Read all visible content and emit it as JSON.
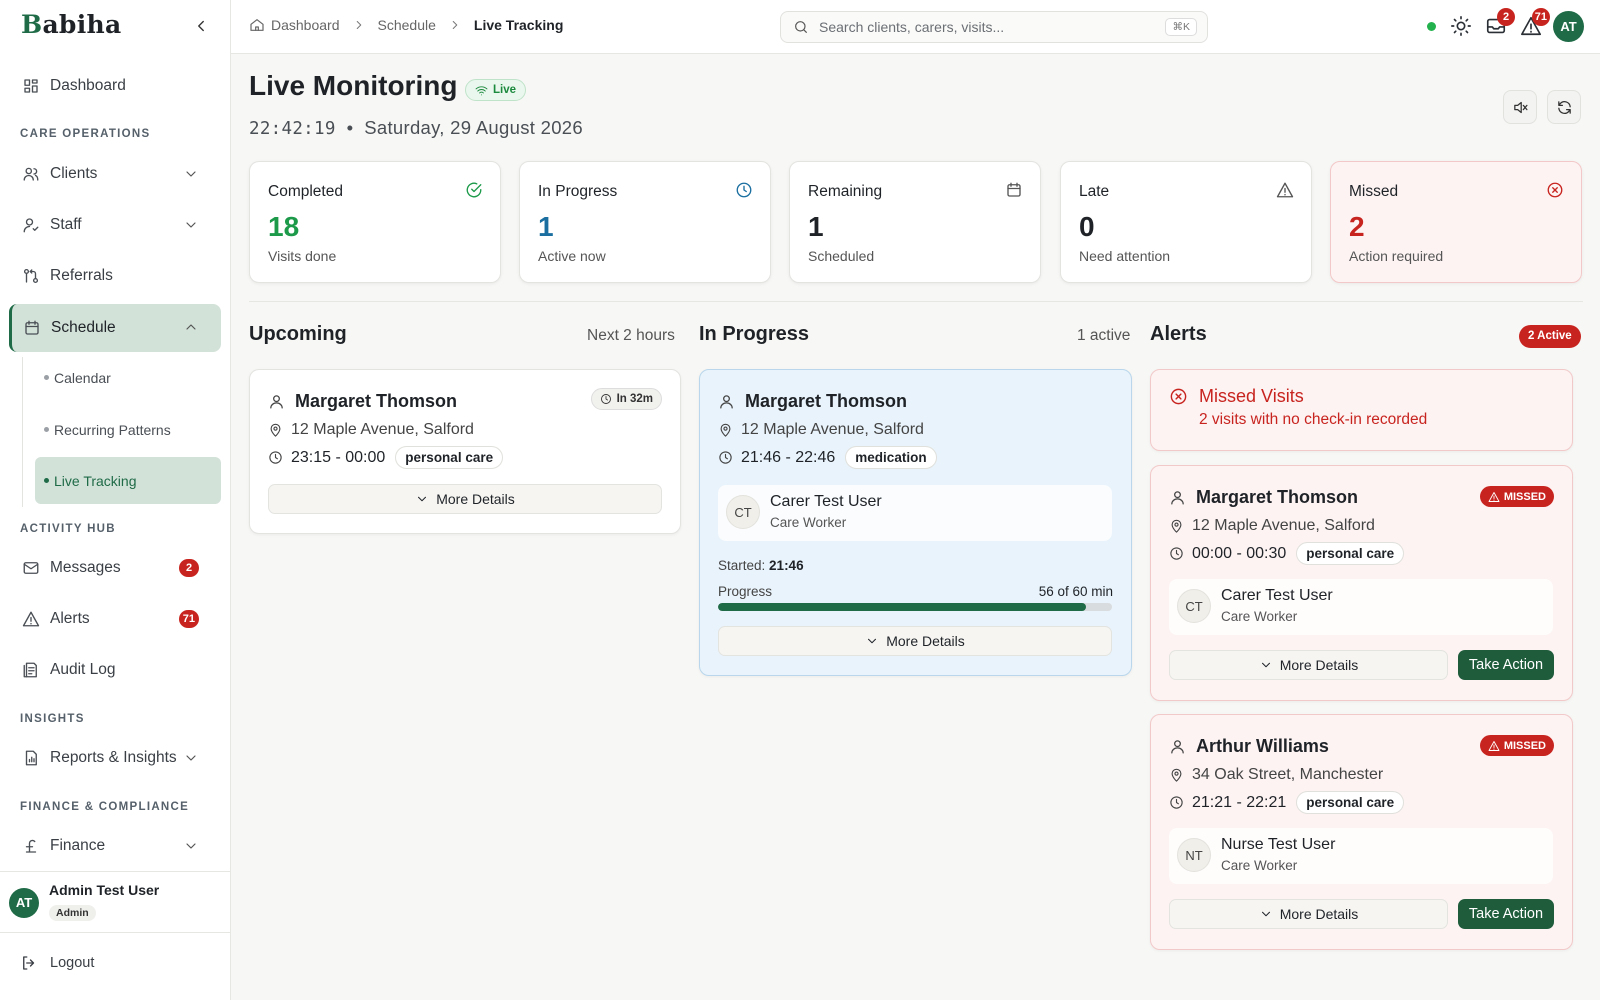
{
  "app": {
    "logo_first": "B",
    "logo_rest": "abiha"
  },
  "sidebar": {
    "dashboard": "Dashboard",
    "sections": {
      "care_ops": "CARE OPERATIONS",
      "activity": "ACTIVITY HUB",
      "insights": "INSIGHTS",
      "finance": "FINANCE & COMPLIANCE"
    },
    "clients": "Clients",
    "staff": "Staff",
    "referrals": "Referrals",
    "schedule": "Schedule",
    "schedule_sub": [
      "Calendar",
      "Recurring Patterns",
      "Live Tracking"
    ],
    "messages": {
      "label": "Messages",
      "count": "2"
    },
    "alerts": {
      "label": "Alerts",
      "count": "71"
    },
    "audit": "Audit Log",
    "reports": "Reports & Insights",
    "finance": "Finance",
    "user": {
      "initials": "AT",
      "name": "Admin Test User",
      "role": "Admin"
    },
    "logout": "Logout"
  },
  "topbar": {
    "breadcrumb": [
      "Dashboard",
      "Schedule",
      "Live Tracking"
    ],
    "search_placeholder": "Search clients, carers, visits...",
    "search_shortcut": "⌘K",
    "messages_badge": "2",
    "alerts_badge": "71",
    "avatar": "AT",
    "online_color": "#22b14c"
  },
  "header": {
    "title": "Live Monitoring",
    "live_label": "Live",
    "time": "22:42:19",
    "date": "Saturday, 29 August 2026"
  },
  "stats": [
    {
      "label": "Completed",
      "value": "18",
      "sub": "Visits done",
      "color": "#1c9a4a",
      "icon": "check-circle-icon"
    },
    {
      "label": "In Progress",
      "value": "1",
      "sub": "Active now",
      "color": "#1a6fa0",
      "icon": "clock-icon"
    },
    {
      "label": "Remaining",
      "value": "1",
      "sub": "Scheduled",
      "color": "#1f2328",
      "icon": "calendar-icon"
    },
    {
      "label": "Late",
      "value": "0",
      "sub": "Need attention",
      "color": "#1f2328",
      "icon": "warning-icon"
    },
    {
      "label": "Missed",
      "value": "2",
      "sub": "Action required",
      "color": "#c8241f",
      "icon": "x-circle-icon"
    }
  ],
  "upcoming": {
    "title": "Upcoming",
    "meta": "Next 2 hours",
    "card": {
      "name": "Margaret Thomson",
      "address": "12 Maple Avenue, Salford",
      "time": "23:15 - 00:00",
      "tag": "personal care",
      "eta": "In 32m",
      "more": "More Details"
    }
  },
  "in_progress": {
    "title": "In Progress",
    "meta": "1 active",
    "card": {
      "name": "Margaret Thomson",
      "address": "12 Maple Avenue, Salford",
      "time": "21:46 - 22:46",
      "tag": "medication",
      "carer": {
        "initials": "CT",
        "name": "Carer Test User",
        "role": "Care Worker"
      },
      "started_label": "Started:",
      "started": "21:46",
      "progress_label": "Progress",
      "progress_text": "56 of 60 min",
      "progress_fraction": 0.933,
      "more": "More Details"
    }
  },
  "alerts": {
    "title": "Alerts",
    "badge": "2 Active",
    "banner": {
      "title": "Missed Visits",
      "desc": "2 visits with no check-in recorded"
    },
    "cards": [
      {
        "name": "Margaret Thomson",
        "status": "MISSED",
        "address": "12 Maple Avenue, Salford",
        "time": "00:00 - 00:30",
        "tag": "personal care",
        "carer": {
          "initials": "CT",
          "name": "Carer Test User",
          "role": "Care Worker"
        },
        "more": "More Details",
        "action": "Take Action"
      },
      {
        "name": "Arthur Williams",
        "status": "MISSED",
        "address": "34 Oak Street, Manchester",
        "time": "21:21 - 22:21",
        "tag": "personal care",
        "carer": {
          "initials": "NT",
          "name": "Nurse Test User",
          "role": "Care Worker"
        },
        "more": "More Details",
        "action": "Take Action"
      }
    ]
  }
}
